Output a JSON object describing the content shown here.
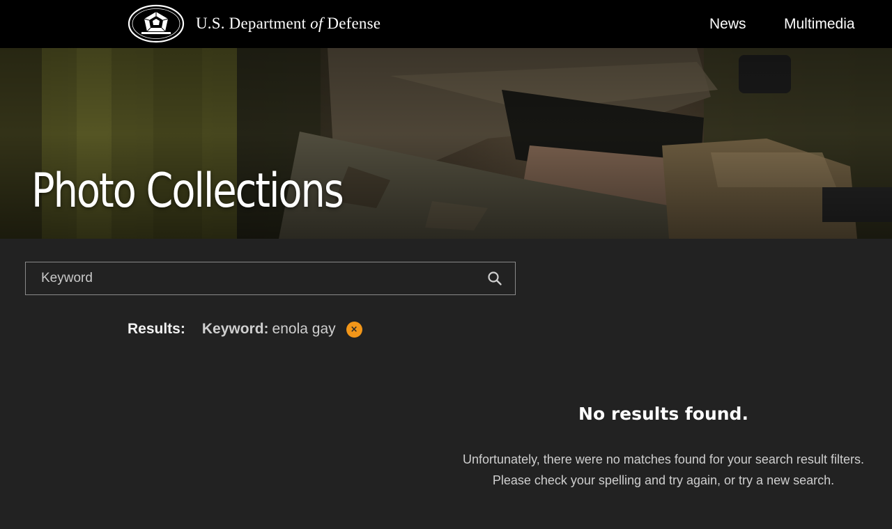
{
  "header": {
    "site_title_prefix": "U.S. Department",
    "site_title_of": "of",
    "site_title_suffix": "Defense",
    "nav": [
      {
        "label": "News"
      },
      {
        "label": "Multimedia"
      }
    ]
  },
  "hero": {
    "title": "Photo Collections"
  },
  "search": {
    "placeholder": "Keyword",
    "value": ""
  },
  "results": {
    "label": "Results:",
    "filter_name": "Keyword:",
    "filter_value": "enola gay",
    "remove_icon": "×"
  },
  "empty_state": {
    "title": "No results found.",
    "line1": "Unfortunately, there were no matches found for your search result filters.",
    "line2": "Please check your spelling and try again, or try a new search."
  },
  "colors": {
    "header_bg": "#000000",
    "page_bg": "#222222",
    "accent": "#f29619"
  }
}
